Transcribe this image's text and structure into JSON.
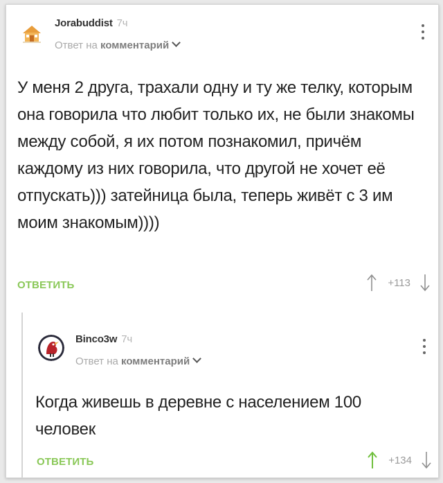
{
  "colors": {
    "accent_green": "#8ac858",
    "upvote_active": "#6fbf3c",
    "upvote_inactive": "#8f8f8f",
    "text_dark": "#222222"
  },
  "comments": [
    {
      "author": "Jorabuddist",
      "time": "7ч",
      "reply_prefix": "Ответ на",
      "reply_target": "комментарий",
      "text": "У меня 2 друга, трахали одну и ту же телку, которым она говорила что любит только их, не были знакомы между собой, я их потом познакомил, причём каждому из них говорила, что другой не хочет её отпускать))) затейница была, теперь живёт с 3 им моим знакомым))))",
      "reply_label": "ОТВЕТИТЬ",
      "rating": "+113",
      "upvoted": false,
      "avatar_icon": "house-avatar-icon"
    },
    {
      "author": "Binco3w",
      "time": "7ч",
      "reply_prefix": "Ответ на",
      "reply_target": "комментарий",
      "text": "Когда живешь в деревне с населением 100 человек",
      "reply_label": "ОТВЕТИТЬ",
      "rating": "+134",
      "upvoted": true,
      "avatar_icon": "bird-avatar-icon"
    }
  ]
}
